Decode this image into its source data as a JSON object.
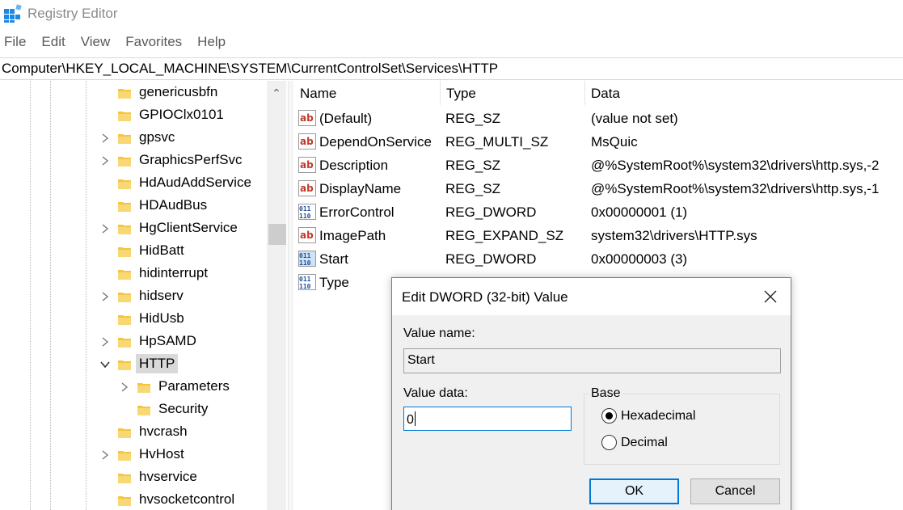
{
  "window": {
    "title": "Registry Editor"
  },
  "menu": [
    "File",
    "Edit",
    "View",
    "Favorites",
    "Help"
  ],
  "address": "Computer\\HKEY_LOCAL_MACHINE\\SYSTEM\\CurrentControlSet\\Services\\HTTP",
  "tree": {
    "items": [
      {
        "label": "genericusbfn",
        "expandable": false,
        "level": 0
      },
      {
        "label": "GPIOClx0101",
        "expandable": false,
        "level": 0
      },
      {
        "label": "gpsvc",
        "expandable": true,
        "level": 0
      },
      {
        "label": "GraphicsPerfSvc",
        "expandable": true,
        "level": 0
      },
      {
        "label": "HdAudAddService",
        "expandable": false,
        "level": 0
      },
      {
        "label": "HDAudBus",
        "expandable": false,
        "level": 0
      },
      {
        "label": "HgClientService",
        "expandable": true,
        "level": 0
      },
      {
        "label": "HidBatt",
        "expandable": false,
        "level": 0
      },
      {
        "label": "hidinterrupt",
        "expandable": false,
        "level": 0
      },
      {
        "label": "hidserv",
        "expandable": true,
        "level": 0
      },
      {
        "label": "HidUsb",
        "expandable": false,
        "level": 0
      },
      {
        "label": "HpSAMD",
        "expandable": true,
        "level": 0
      },
      {
        "label": "HTTP",
        "expandable": true,
        "expanded": true,
        "selected": true,
        "level": 0
      },
      {
        "label": "Parameters",
        "expandable": true,
        "level": 1
      },
      {
        "label": "Security",
        "expandable": false,
        "level": 1
      },
      {
        "label": "hvcrash",
        "expandable": false,
        "level": 0
      },
      {
        "label": "HvHost",
        "expandable": true,
        "level": 0
      },
      {
        "label": "hvservice",
        "expandable": false,
        "level": 0
      },
      {
        "label": "hvsocketcontrol",
        "expandable": false,
        "level": 0
      }
    ]
  },
  "list": {
    "columns": {
      "name": "Name",
      "type": "Type",
      "data": "Data"
    },
    "rows": [
      {
        "name": "(Default)",
        "type": "REG_SZ",
        "data": "(value not set)",
        "icon": "string-value-icon"
      },
      {
        "name": "DependOnService",
        "type": "REG_MULTI_SZ",
        "data": "MsQuic",
        "icon": "string-value-icon"
      },
      {
        "name": "Description",
        "type": "REG_SZ",
        "data": "@%SystemRoot%\\system32\\drivers\\http.sys,-2",
        "icon": "string-value-icon"
      },
      {
        "name": "DisplayName",
        "type": "REG_SZ",
        "data": "@%SystemRoot%\\system32\\drivers\\http.sys,-1",
        "icon": "string-value-icon"
      },
      {
        "name": "ErrorControl",
        "type": "REG_DWORD",
        "data": "0x00000001 (1)",
        "icon": "binary-value-icon"
      },
      {
        "name": "ImagePath",
        "type": "REG_EXPAND_SZ",
        "data": "system32\\drivers\\HTTP.sys",
        "icon": "string-value-icon"
      },
      {
        "name": "Start",
        "type": "REG_DWORD",
        "data": "0x00000003 (3)",
        "icon": "binary-value-icon",
        "selected": true
      },
      {
        "name": "Type",
        "type": "",
        "data": "",
        "icon": "binary-value-icon"
      }
    ]
  },
  "dialog": {
    "title": "Edit DWORD (32-bit) Value",
    "value_name_label": "Value name:",
    "value_name": "Start",
    "value_data_label": "Value data:",
    "value_data": "0",
    "base_label": "Base",
    "base_options": [
      {
        "label": "Hexadecimal",
        "checked": true
      },
      {
        "label": "Decimal",
        "checked": false
      }
    ],
    "ok_label": "OK",
    "cancel_label": "Cancel"
  },
  "colors": {
    "accent": "#0078d7",
    "folder": "#f5c542",
    "string_icon": "#c0392b",
    "binary_icon": "#1f4e9c"
  }
}
